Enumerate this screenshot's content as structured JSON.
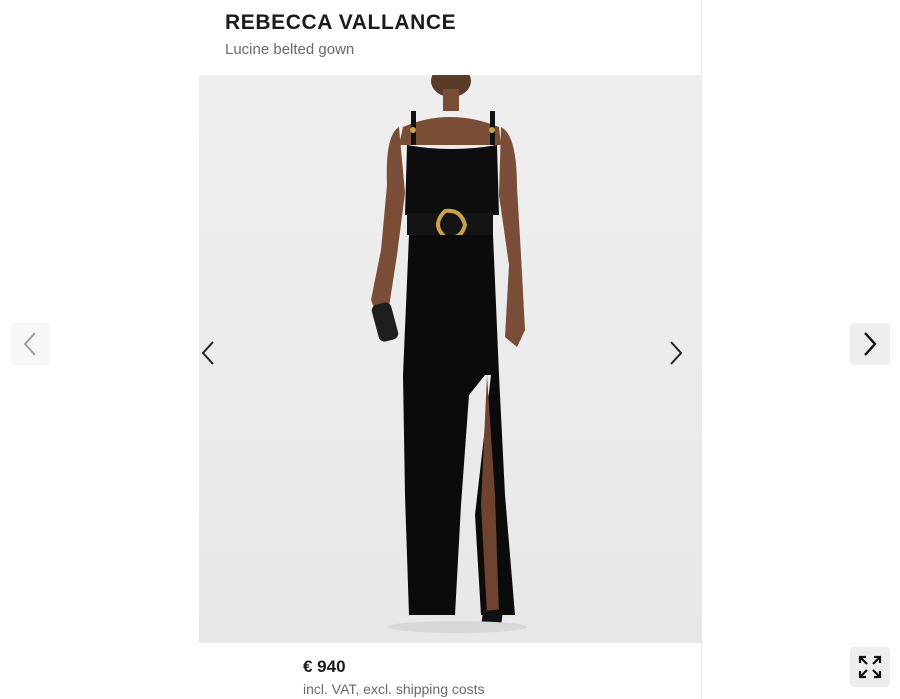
{
  "product": {
    "brand": "REBECCA VALLANCE",
    "name": "Lucine belted gown",
    "price": "€ 940",
    "vat_note": "incl. VAT, excl. shipping costs"
  },
  "gallery": {
    "prev_icon": "chevron-left-icon",
    "next_icon": "chevron-right-icon",
    "fullscreen_icon": "expand-icon",
    "image_subject": "model-wearing-black-gown"
  },
  "colors": {
    "text_primary": "#1b1b1b",
    "text_secondary": "#6a6a6a",
    "image_background": "#ececec",
    "button_background": "#eeeeee",
    "inactive_arrow": "#9aa0a6"
  }
}
